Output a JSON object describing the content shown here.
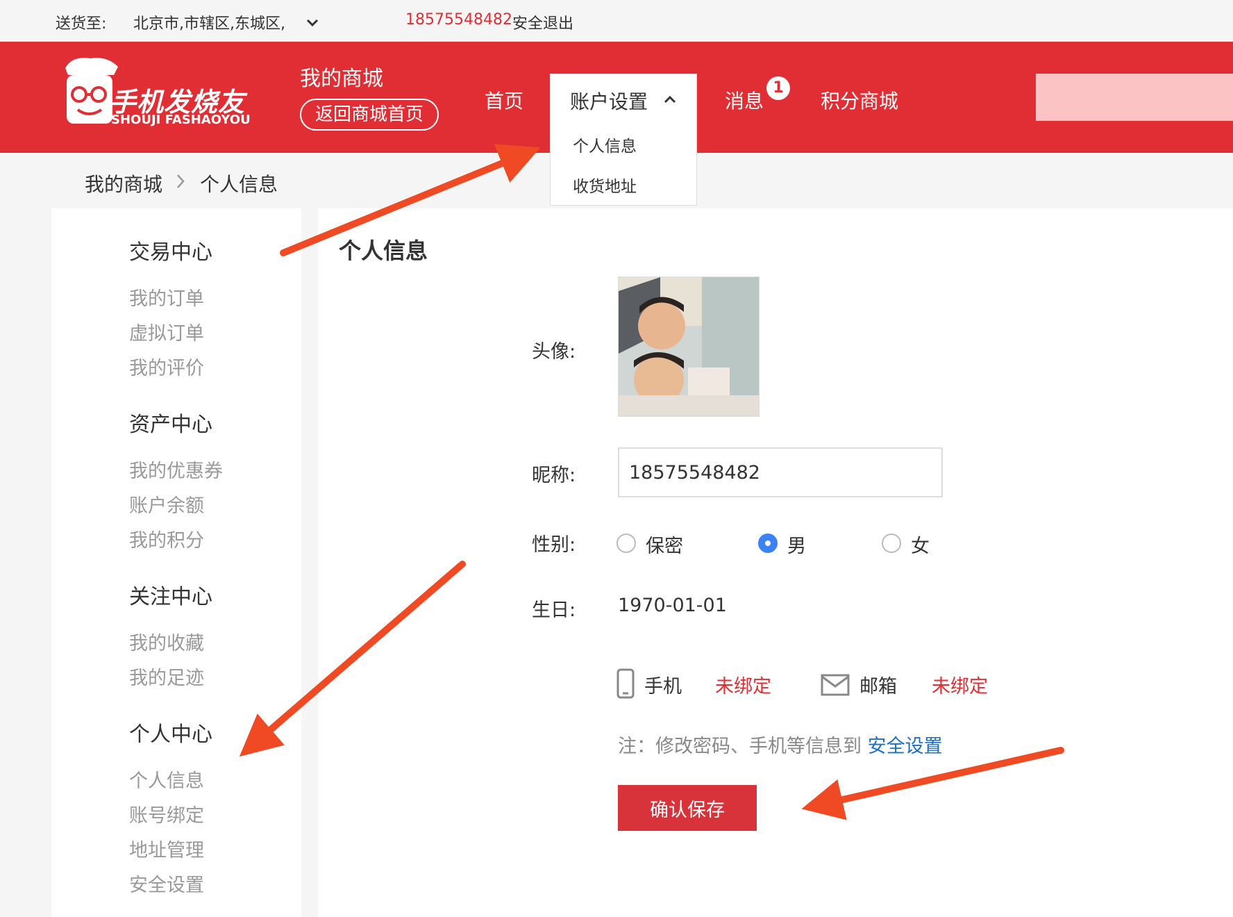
{
  "topbar": {
    "ship_to_label": "送货至:",
    "location": "北京市,市辖区,东城区,",
    "phone": "18575548482",
    "logout": "安全退出",
    "accent_color": "#e02e34"
  },
  "header": {
    "logo_cn": "手机发烧友",
    "logo_en": "SHOUJI FASHAOYOU",
    "mall_title": "我的商城",
    "back_button": "返回商城首页",
    "bg_color": "#e02e34"
  },
  "nav": {
    "home": "首页",
    "account_settings": "账户设置",
    "dropdown_items": [
      "个人信息",
      "收货地址"
    ],
    "messages": "消息",
    "messages_badge": "1",
    "points_mall": "积分商城"
  },
  "breadcrumb": {
    "root": "我的商城",
    "current": "个人信息"
  },
  "sidebar": {
    "groups": [
      {
        "title": "交易中心",
        "links": [
          "我的订单",
          "虚拟订单",
          "我的评价"
        ]
      },
      {
        "title": "资产中心",
        "links": [
          "我的优惠券",
          "账户余额",
          "我的积分"
        ]
      },
      {
        "title": "关注中心",
        "links": [
          "我的收藏",
          "我的足迹"
        ]
      },
      {
        "title": "个人中心",
        "links": [
          "个人信息",
          "账号绑定",
          "地址管理",
          "安全设置"
        ]
      }
    ]
  },
  "main": {
    "title": "个人信息",
    "avatar_label": "头像:",
    "nickname_label": "昵称:",
    "nickname_value": "18575548482",
    "gender_label": "性别:",
    "gender_options": [
      "保密",
      "男",
      "女"
    ],
    "gender_selected": "男",
    "birthday_label": "生日:",
    "birthday_value": "1970-01-01",
    "phone_label": "手机",
    "phone_status": "未绑定",
    "email_label": "邮箱",
    "email_status": "未绑定",
    "note_text": "注：修改密码、手机等信息到",
    "note_link": "安全设置",
    "save_button": "确认保存",
    "status_color": "#e02e34",
    "link_color": "#1a6fc9"
  }
}
